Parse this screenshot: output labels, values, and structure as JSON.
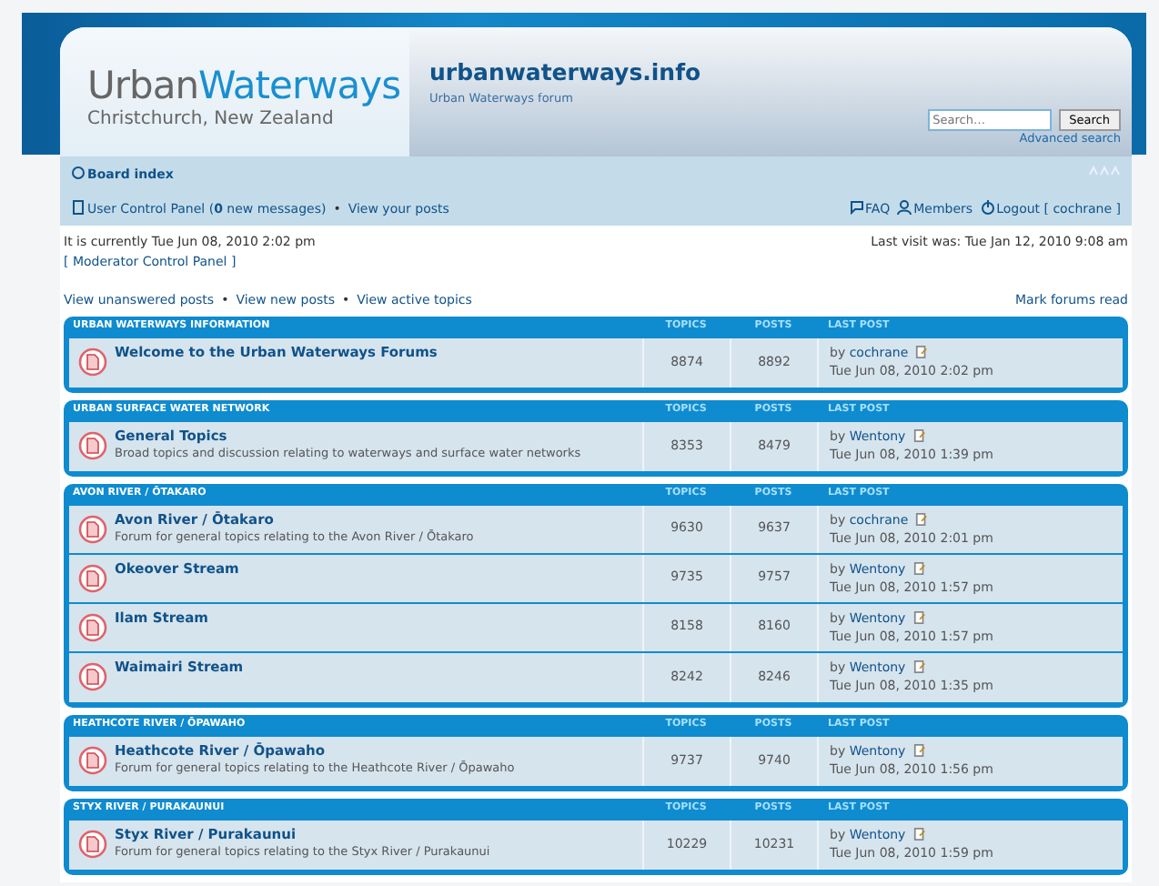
{
  "header": {
    "logo_main": "Urban",
    "logo_accent": "Waterways",
    "logo_subtitle": "Christchurch, New Zealand",
    "site_title": "urbanwaterways.info",
    "site_description": "Urban Waterways forum",
    "search": {
      "placeholder": "Search…"
    },
    "search_button": "Search",
    "advanced_search": "Advanced search"
  },
  "navbar": {
    "breadcrumb": "Board index",
    "user_links": [
      {
        "kind": "ucp",
        "text": "User Control Panel (**0** new messages)"
      },
      {
        "kind": "plain",
        "text": "View your posts"
      }
    ],
    "right_links": [
      {
        "kind": "faq",
        "text": "FAQ"
      },
      {
        "kind": "members",
        "text": "Members"
      },
      {
        "kind": "logout",
        "text": "Logout [ cochrane ]"
      }
    ]
  },
  "info": {
    "current_time": "It is currently Tue Jun 08, 2010 2:02 pm",
    "moderator_panel": "[ Moderator Control Panel ]",
    "last_visit": "Last visit was: Tue Jan 12, 2010 9:08 am"
  },
  "links": [
    "View unanswered posts",
    "View new posts",
    "View active topics"
  ],
  "mark_read": "Mark forums read",
  "categories": [
    {
      "title": "URBAN WATERWAYS INFORMATION",
      "columns": [
        "TOPICS",
        "POSTS",
        "LAST POST"
      ],
      "forums": [
        {
          "name": "Welcome to the Urban Waterways Forums",
          "topics": "8874",
          "posts": "8892",
          "by": "by",
          "author": "cochrane",
          "date": "Tue Jun 08, 2010 2:02 pm"
        }
      ]
    },
    {
      "title": "URBAN SURFACE WATER NETWORK",
      "columns": [
        "TOPICS",
        "POSTS",
        "LAST POST"
      ],
      "forums": [
        {
          "name": "General Topics",
          "description": "Broad topics and discussion relating to waterways and surface water networks",
          "topics": "8353",
          "posts": "8479",
          "by": "by",
          "author": "Wentony",
          "date": "Tue Jun 08, 2010 1:39 pm"
        }
      ]
    },
    {
      "title": "AVON RIVER / ŌTAKARO",
      "columns": [
        "TOPICS",
        "POSTS",
        "LAST POST"
      ],
      "forums": [
        {
          "name": "Avon River / Ōtakaro",
          "description": "Forum for general topics relating to the Avon River / Ōtakaro",
          "topics": "9630",
          "posts": "9637",
          "by": "by",
          "author": "cochrane",
          "date": "Tue Jun 08, 2010 2:01 pm"
        },
        {
          "name": "Okeover Stream",
          "topics": "9735",
          "posts": "9757",
          "by": "by",
          "author": "Wentony",
          "date": "Tue Jun 08, 2010 1:57 pm"
        },
        {
          "name": "Ilam Stream",
          "topics": "8158",
          "posts": "8160",
          "by": "by",
          "author": "Wentony",
          "date": "Tue Jun 08, 2010 1:57 pm"
        },
        {
          "name": "Waimairi Stream",
          "topics": "8242",
          "posts": "8246",
          "by": "by",
          "author": "Wentony",
          "date": "Tue Jun 08, 2010 1:35 pm"
        }
      ]
    },
    {
      "title": "HEATHCOTE RIVER / ŌPAWAHO",
      "columns": [
        "TOPICS",
        "POSTS",
        "LAST POST"
      ],
      "forums": [
        {
          "name": "Heathcote River / Ōpawaho",
          "description": "Forum for general topics relating to the Heathcote River / Ōpawaho",
          "topics": "9737",
          "posts": "9740",
          "by": "by",
          "author": "Wentony",
          "date": "Tue Jun 08, 2010 1:56 pm"
        }
      ]
    },
    {
      "title": "STYX RIVER / PURAKAUNUI",
      "columns": [
        "TOPICS",
        "POSTS",
        "LAST POST"
      ],
      "forums": [
        {
          "name": "Styx River / Purakaunui",
          "description": "Forum for general topics relating to the Styx River / Purakaunui",
          "topics": "10229",
          "posts": "10231",
          "by": "by",
          "author": "Wentony",
          "date": "Tue Jun 08, 2010 1:59 pm"
        }
      ]
    }
  ],
  "separator": "•"
}
